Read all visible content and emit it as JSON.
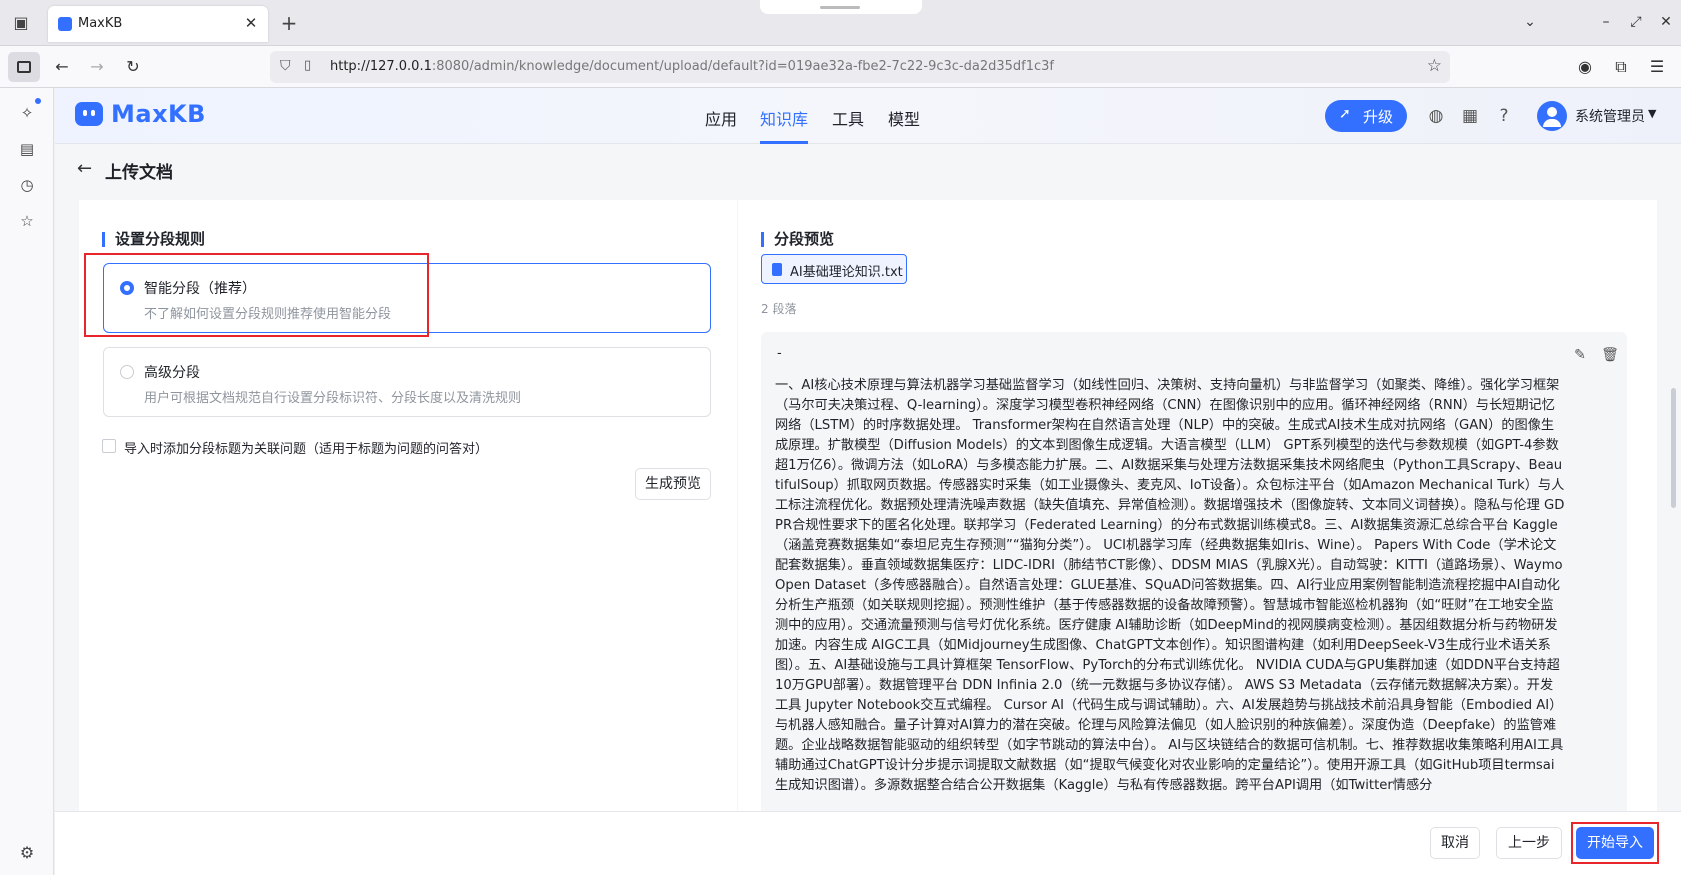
{
  "browser": {
    "tab_title": "MaxKB",
    "url_host": "http://127.0.0.1",
    "url_rest": ":8080/admin/knowledge/document/upload/default?id=019ae32a-fbe2-7c22-9c3c-da2d35df1c3f"
  },
  "app": {
    "logo_text": "MaxKB",
    "nav": [
      "应用",
      "知识库",
      "工具",
      "模型"
    ],
    "active_nav": "知识库",
    "upgrade_label": "升级",
    "username": "系统管理员"
  },
  "page": {
    "title": "上传文档"
  },
  "left": {
    "section_title": "设置分段规则",
    "option_smart_title": "智能分段（推荐）",
    "option_smart_desc": "不了解如何设置分段规则推荐使用智能分段",
    "option_adv_title": "高级分段",
    "option_adv_desc": "用户可根据文档规范自行设置分段标识符、分段长度以及清洗规则",
    "checkbox_label": "导入时添加分段标题为关联问题（适用于标题为问题的问答对）",
    "preview_btn": "生成预览"
  },
  "right": {
    "section_title": "分段预览",
    "file_name": "AI基础理论知识.txt",
    "segment_count": "2 段落",
    "segment_title": "-",
    "segment_text": "一、AI核心技术原理与算法机器学习基础监督学习（如线性回归、决策树、支持向量机）与非监督学习（如聚类、降维）。强化学习框架（马尔可夫决策过程、Q-learning）。深度学习模型卷积神经网络（CNN）在图像识别中的应用。循环神经网络（RNN）与长短期记忆网络（LSTM）的时序数据处理。 Transformer架构在自然语言处理（NLP）中的突破。生成式AI技术生成对抗网络（GAN）的图像生成原理。扩散模型（Diffusion Models）的文本到图像生成逻辑。大语言模型（LLM） GPT系列模型的迭代与参数规模（如GPT-4参数超1万亿6）。微调方法（如LoRA）与多模态能力扩展。二、AI数据采集与处理方法数据采集技术网络爬虫（Python工具Scrapy、BeautifulSoup）抓取网页数据。传感器实时采集（如工业摄像头、麦克风、IoT设备）。众包标注平台（如Amazon Mechanical Turk）与人工标注流程优化。数据预处理清洗噪声数据（缺失值填充、异常值检测）。数据增强技术（图像旋转、文本同义词替换）。隐私与伦理 GDPR合规性要求下的匿名化处理。联邦学习（Federated Learning）的分布式数据训练模式8。三、AI数据集资源汇总综合平台 Kaggle（涵盖竞赛数据集如“泰坦尼克生存预测”“猫狗分类”）。 UCI机器学习库（经典数据集如Iris、Wine）。 Papers With Code（学术论文配套数据集）。垂直领域数据集医疗：LIDC-IDRI（肺结节CT影像）、DDSM MIAS（乳腺X光）。自动驾驶：KITTI（道路场景）、Waymo Open Dataset（多传感器融合）。自然语言处理：GLUE基准、SQuAD问答数据集。四、AI行业应用案例智能制造流程挖掘中AI自动化分析生产瓶颈（如关联规则挖掘）。预测性维护（基于传感器数据的设备故障预警）。智慧城市智能巡检机器狗（如“旺财”在工地安全监测中的应用）。交通流量预测与信号灯优化系统。医疗健康 AI辅助诊断（如DeepMind的视网膜病变检测）。基因组数据分析与药物研发加速。内容生成 AIGC工具（如Midjourney生成图像、ChatGPT文本创作）。知识图谱构建（如利用DeepSeek-V3生成行业术语关系图）。五、AI基础设施与工具计算框架 TensorFlow、PyTorch的分布式训练优化。 NVIDIA CUDA与GPU集群加速（如DDN平台支持超10万GPU部署）。数据管理平台 DDN Infinia 2.0（统一元数据与多协议存储）。 AWS S3 Metadata（云存储元数据解决方案）。开发工具 Jupyter Notebook交互式编程。 Cursor AI（代码生成与调试辅助）。六、AI发展趋势与挑战技术前沿具身智能（Embodied AI）与机器人感知融合。量子计算对AI算力的潜在突破。伦理与风险算法偏见（如人脸识别的种族偏差）。深度伪造（Deepfake）的监管难题。企业战略数据智能驱动的组织转型（如字节跳动的算法中台）。 AI与区块链结合的数据可信机制。七、推荐数据收集策略利用AI工具辅助通过ChatGPT设计分步提示词提取文献数据（如“提取气候变化对农业影响的定量结论”）。使用开源工具（如GitHub项目termsai生成知识图谱）。多源数据整合结合公开数据集（Kaggle）与私有传感器数据。跨平台API调用（如Twitter情感分"
  },
  "footer": {
    "cancel": "取消",
    "prev": "上一步",
    "start": "开始导入"
  },
  "colors": {
    "accent": "#3370ff",
    "highlight": "#e8252a"
  }
}
